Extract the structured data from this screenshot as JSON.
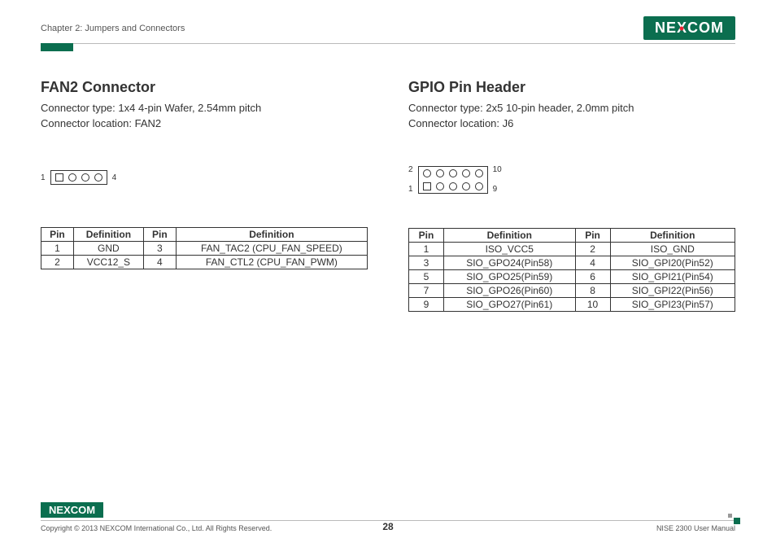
{
  "header": {
    "chapter": "Chapter 2: Jumpers and Connectors",
    "brand": "NEXCOM"
  },
  "left": {
    "title": "FAN2 Connector",
    "type_line": "Connector type: 1x4 4-pin Wafer, 2.54mm pitch",
    "loc_line": "Connector location: FAN2",
    "diag_left": "1",
    "diag_right": "4",
    "headers": {
      "pin": "Pin",
      "def": "Definition"
    },
    "rows": [
      {
        "p1": "1",
        "d1": "GND",
        "p2": "3",
        "d2": "FAN_TAC2 (CPU_FAN_SPEED)"
      },
      {
        "p1": "2",
        "d1": "VCC12_S",
        "p2": "4",
        "d2": "FAN_CTL2 (CPU_FAN_PWM)"
      }
    ]
  },
  "right": {
    "title": "GPIO Pin Header",
    "type_line": "Connector type: 2x5 10-pin header, 2.0mm pitch",
    "loc_line": "Connector location: J6",
    "diag_tl": "2",
    "diag_tr": "10",
    "diag_bl": "1",
    "diag_br": "9",
    "headers": {
      "pin": "Pin",
      "def": "Definition"
    },
    "rows": [
      {
        "p1": "1",
        "d1": "ISO_VCC5",
        "p2": "2",
        "d2": "ISO_GND"
      },
      {
        "p1": "3",
        "d1": "SIO_GPO24(Pin58)",
        "p2": "4",
        "d2": "SIO_GPI20(Pin52)"
      },
      {
        "p1": "5",
        "d1": "SIO_GPO25(Pin59)",
        "p2": "6",
        "d2": "SIO_GPI21(Pin54)"
      },
      {
        "p1": "7",
        "d1": "SIO_GPO26(Pin60)",
        "p2": "8",
        "d2": "SIO_GPI22(Pin56)"
      },
      {
        "p1": "9",
        "d1": "SIO_GPO27(Pin61)",
        "p2": "10",
        "d2": "SIO_GPI23(Pin57)"
      }
    ]
  },
  "footer": {
    "copyright": "Copyright © 2013 NEXCOM International Co., Ltd. All Rights Reserved.",
    "page": "28",
    "doc": "NISE 2300 User Manual",
    "brand": "NEXCOM"
  }
}
